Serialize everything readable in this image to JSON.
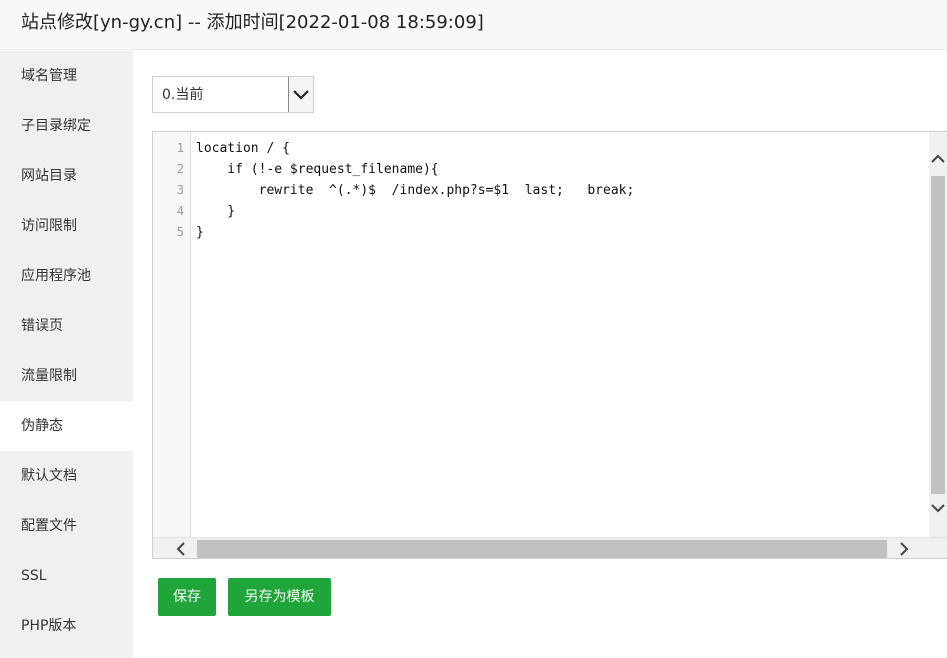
{
  "header": {
    "title": "站点修改[yn-gy.cn] -- 添加时间[2022-01-08 18:59:09]"
  },
  "sidebar": {
    "items": [
      {
        "label": "域名管理"
      },
      {
        "label": "子目录绑定"
      },
      {
        "label": "网站目录"
      },
      {
        "label": "访问限制"
      },
      {
        "label": "应用程序池"
      },
      {
        "label": "错误页"
      },
      {
        "label": "流量限制"
      },
      {
        "label": "伪静态",
        "active": true
      },
      {
        "label": "默认文档"
      },
      {
        "label": "配置文件"
      },
      {
        "label": "SSL"
      },
      {
        "label": "PHP版本"
      }
    ]
  },
  "rewrite_select": {
    "selected": "0.当前"
  },
  "editor": {
    "line_numbers": [
      "1",
      "2",
      "3",
      "4",
      "5"
    ],
    "lines": [
      "location / {",
      "    if (!-e $request_filename){",
      "        rewrite  ^(.*)$  /index.php?s=$1  last;   break;",
      "    }",
      "}"
    ]
  },
  "actions": {
    "save_label": "保存",
    "save_template_label": "另存为模板"
  },
  "colors": {
    "accent": "#20a53a",
    "sidebar_bg": "#f0f0f0",
    "header_bg": "#f8f8f8"
  },
  "icons": {
    "select_arrow": "chevron-down-icon",
    "scroll_up": "chevron-up-icon",
    "scroll_down": "chevron-down-icon",
    "scroll_left": "chevron-left-icon",
    "scroll_right": "chevron-right-icon"
  }
}
